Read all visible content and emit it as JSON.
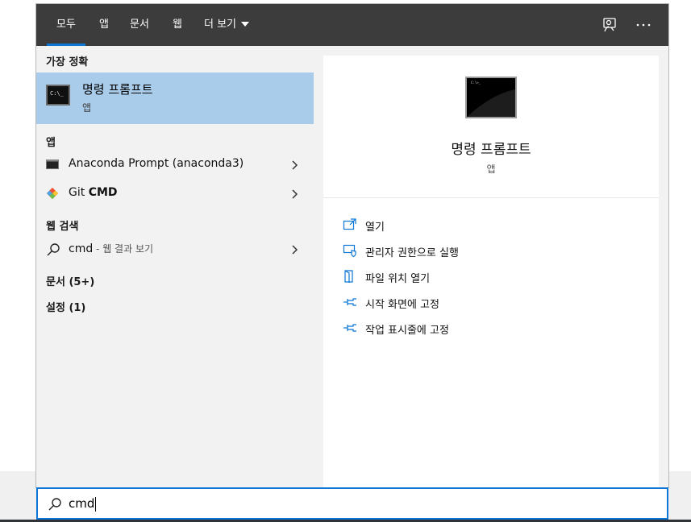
{
  "tabs": [
    {
      "label": "모두",
      "active": true
    },
    {
      "label": "앱"
    },
    {
      "label": "문서"
    },
    {
      "label": "웹"
    },
    {
      "label": "더 보기"
    }
  ],
  "topbar_icons": [
    "feedback-icon",
    "more-options-icon"
  ],
  "sections": {
    "best_match": "가장 정확",
    "apps": "앱",
    "web": "웹 검색",
    "documents": "문서 (5+)",
    "settings": "설정 (1)"
  },
  "best_match": {
    "title": "명령 프롬프트",
    "subtitle": "앱",
    "icon_text": "C:\\_"
  },
  "apps": [
    {
      "label": "Anaconda Prompt (anaconda3)",
      "icon": "terminal-icon"
    },
    {
      "label_prefix": "Git ",
      "label_bold": "CMD",
      "icon": "git-icon"
    }
  ],
  "web_result": {
    "query": "cmd",
    "suffix": " - 웹 결과 보기"
  },
  "detail": {
    "title": "명령 프롬프트",
    "subtitle": "앱",
    "icon_text": "C:\\>_",
    "actions": [
      {
        "label": "열기",
        "icon": "open-icon"
      },
      {
        "label": "관리자 권한으로 실행",
        "icon": "shield-run-icon"
      },
      {
        "label": "파일 위치 열기",
        "icon": "file-location-icon"
      },
      {
        "label": "시작 화면에 고정",
        "icon": "pin-icon"
      },
      {
        "label": "작업 표시줄에 고정",
        "icon": "pin-icon"
      }
    ]
  },
  "search": {
    "value": "cmd"
  },
  "colors": {
    "accent": "#0b76d6",
    "selected": "#aacceb",
    "topbar": "#3c3c3c"
  }
}
